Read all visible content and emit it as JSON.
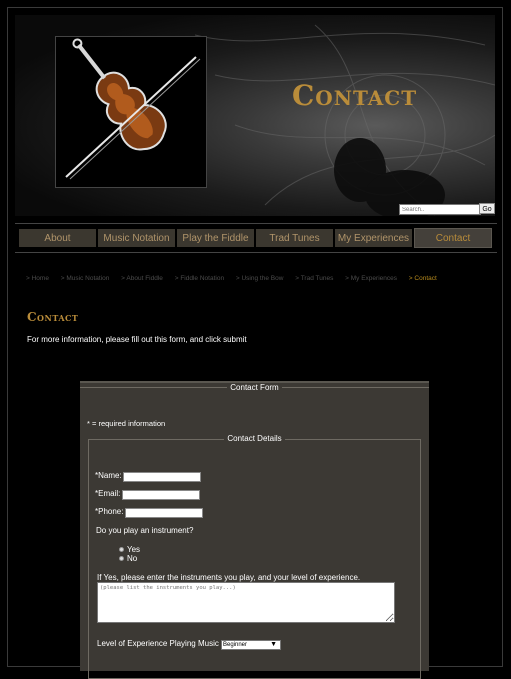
{
  "header": {
    "title": "Contact",
    "search_placeholder": "Search..",
    "search_button": "Go"
  },
  "nav": {
    "items": [
      {
        "label": "About"
      },
      {
        "label": "Music Notation"
      },
      {
        "label": "Play the Fiddle"
      },
      {
        "label": "Trad Tunes"
      },
      {
        "label": "My Experiences"
      },
      {
        "label": "Contact",
        "active": true
      }
    ]
  },
  "breadcrumb": [
    "> Home",
    "> Music Notation",
    "> About Fiddle",
    "> Fiddle Notation",
    "> Using the Bow",
    "> Trad Tunes",
    "> My Experiences",
    "> Contact"
  ],
  "main": {
    "heading": "Contact",
    "intro": "For more information, please fill out this form, and click submit"
  },
  "form": {
    "legend": "Contact Form",
    "required_note": "* = required information",
    "details_legend": "Contact Details",
    "name_label": "*Name:",
    "email_label": "*Email:",
    "phone_label": "*Phone:",
    "instrument_question": "Do you play an instrument?",
    "yes_label": "Yes",
    "no_label": "No",
    "instruments_prompt": "If Yes, please enter the instruments you play, and your level of experience.",
    "instruments_placeholder": "(please list the instruments you play...)",
    "experience_label": "Level of Experience Playing Music",
    "experience_value": "Beginner"
  },
  "colors": {
    "accent": "#b98c3a",
    "nav_bg": "#3b372f",
    "panel_bg": "#3c3934"
  }
}
